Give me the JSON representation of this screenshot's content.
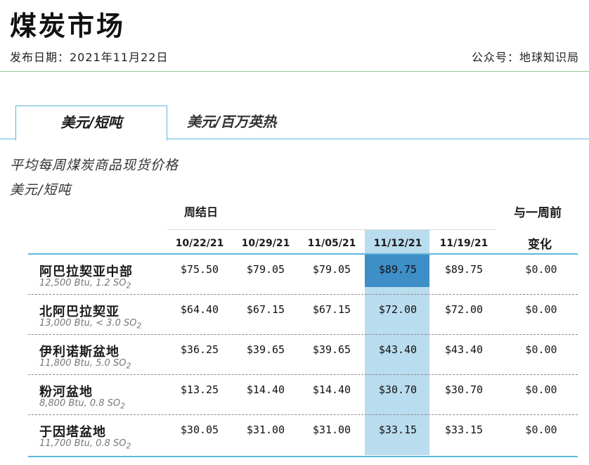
{
  "header": {
    "title": "煤炭市场",
    "publish_date": "发布日期：2021年11月22日",
    "source": "公众号：地球知识局"
  },
  "tabs": [
    {
      "label": "美元/短吨",
      "active": true
    },
    {
      "label": "美元/百万英热",
      "active": false
    }
  ],
  "table": {
    "subtitle": "平均每周煤炭商品现货价格",
    "unit": "美元/短吨",
    "week_ending_label": "周结日",
    "change_label_line1": "与一周前",
    "change_label_line2": "变化",
    "dates": [
      "10/22/21",
      "10/29/21",
      "11/05/21",
      "11/12/21",
      "11/19/21"
    ],
    "highlight_date_index": 3,
    "rows": [
      {
        "region": "阿巴拉契亚中部",
        "spec": "12,500 Btu, 1.2 SO",
        "spec_sub": "2",
        "prices": [
          "$75.50",
          "$79.05",
          "$79.05",
          "$89.75",
          "$89.75"
        ],
        "change": "$0.00"
      },
      {
        "region": "北阿巴拉契亚",
        "spec": "13,000 Btu, < 3.0 SO",
        "spec_sub": "2",
        "prices": [
          "$64.40",
          "$67.15",
          "$67.15",
          "$72.00",
          "$72.00"
        ],
        "change": "$0.00"
      },
      {
        "region": "伊利诺斯盆地",
        "spec": "11,800 Btu, 5.0 SO",
        "spec_sub": "2",
        "prices": [
          "$36.25",
          "$39.65",
          "$39.65",
          "$43.40",
          "$43.40"
        ],
        "change": "$0.00"
      },
      {
        "region": "粉河盆地",
        "spec": "8,800 Btu, 0.8 SO",
        "spec_sub": "2",
        "prices": [
          "$13.25",
          "$14.40",
          "$14.40",
          "$30.70",
          "$30.70"
        ],
        "change": "$0.00"
      },
      {
        "region": "于因塔盆地",
        "spec": "11,700 Btu, 0.8 SO",
        "spec_sub": "2",
        "prices": [
          "$30.05",
          "$31.00",
          "$31.00",
          "$33.15",
          "$33.15"
        ],
        "change": "$0.00"
      }
    ]
  },
  "colors": {
    "accent_blue": "#5ab8dc",
    "highlight_column": "#b9dcee",
    "highlight_cell": "#3e8ec7",
    "divider_green": "#8fc79a"
  }
}
